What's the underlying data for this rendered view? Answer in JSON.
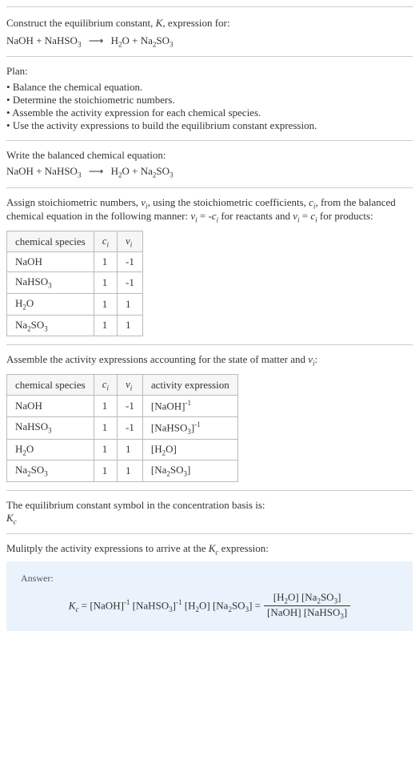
{
  "header": {
    "prompt_line1": "Construct the equilibrium constant, ",
    "prompt_k": "K",
    "prompt_line1b": ", expression for:"
  },
  "equation": {
    "lhs1": "NaOH",
    "plus": " + ",
    "lhs2_a": "NaHSO",
    "lhs2_sub": "3",
    "arrow": "⟶",
    "rhs1_a": "H",
    "rhs1_sub": "2",
    "rhs1_b": "O",
    "rhs2_a": "Na",
    "rhs2_sub1": "2",
    "rhs2_b": "SO",
    "rhs2_sub2": "3"
  },
  "plan": {
    "title": "Plan:",
    "items": [
      "Balance the chemical equation.",
      "Determine the stoichiometric numbers.",
      "Assemble the activity expression for each chemical species.",
      "Use the activity expressions to build the equilibrium constant expression."
    ]
  },
  "balanced": {
    "title": "Write the balanced chemical equation:"
  },
  "stoich": {
    "intro_a": "Assign stoichiometric numbers, ",
    "nu": "ν",
    "sub_i": "i",
    "intro_b": ", using the stoichiometric coefficients, ",
    "c": "c",
    "intro_c": ", from the balanced chemical equation in the following manner: ",
    "eq1": " = -",
    "intro_d": " for reactants and ",
    "eq2": " = ",
    "intro_e": " for products:",
    "headers": {
      "species": "chemical species",
      "c": "c",
      "nu": "ν",
      "i": "i"
    },
    "rows": [
      {
        "species_a": "NaOH",
        "species_sub": "",
        "species_b": "",
        "species_sub2": "",
        "c": "1",
        "nu": "-1"
      },
      {
        "species_a": "NaHSO",
        "species_sub": "3",
        "species_b": "",
        "species_sub2": "",
        "c": "1",
        "nu": "-1"
      },
      {
        "species_a": "H",
        "species_sub": "2",
        "species_b": "O",
        "species_sub2": "",
        "c": "1",
        "nu": "1"
      },
      {
        "species_a": "Na",
        "species_sub": "2",
        "species_b": "SO",
        "species_sub2": "3",
        "c": "1",
        "nu": "1"
      }
    ]
  },
  "activity": {
    "title_a": "Assemble the activity expressions accounting for the state of matter and ",
    "title_b": ":",
    "headers": {
      "species": "chemical species",
      "c": "c",
      "nu": "ν",
      "i": "i",
      "activity": "activity expression"
    },
    "rows": [
      {
        "species_a": "NaOH",
        "species_sub": "",
        "species_b": "",
        "species_sub2": "",
        "c": "1",
        "nu": "-1",
        "act_a": "[NaOH]",
        "act_sup": "-1",
        "act_b": "",
        "act_sub": "",
        "act_c": ""
      },
      {
        "species_a": "NaHSO",
        "species_sub": "3",
        "species_b": "",
        "species_sub2": "",
        "c": "1",
        "nu": "-1",
        "act_a": "[NaHSO",
        "act_sup": "-1",
        "act_b": "",
        "act_sub": "3",
        "act_c": "]"
      },
      {
        "species_a": "H",
        "species_sub": "2",
        "species_b": "O",
        "species_sub2": "",
        "c": "1",
        "nu": "1",
        "act_a": "[H",
        "act_sup": "",
        "act_b": "O]",
        "act_sub": "2",
        "act_c": ""
      },
      {
        "species_a": "Na",
        "species_sub": "2",
        "species_b": "SO",
        "species_sub2": "3",
        "c": "1",
        "nu": "1",
        "act_a": "[Na",
        "act_sup": "",
        "act_b": "SO",
        "act_sub": "2",
        "act_c": ""
      }
    ]
  },
  "eqsymbol": {
    "line1": "The equilibrium constant symbol in the concentration basis is:",
    "k": "K",
    "c": "c"
  },
  "multiply": {
    "line_a": "Mulitply the activity expressions to arrive at the ",
    "k": "K",
    "c": "c",
    "line_b": " expression:"
  },
  "answer": {
    "label": "Answer:",
    "k": "K",
    "c": "c",
    "eq": " = ",
    "t1": "[NaOH]",
    "sup1": "-1",
    "sp": " ",
    "t2a": "[NaHSO",
    "t2sub": "3",
    "t2b": "]",
    "sup2": "-1",
    "t3a": "[H",
    "t3sub": "2",
    "t3b": "O]",
    "t4a": "[Na",
    "t4sub1": "2",
    "t4b": "SO",
    "t4sub2": "3",
    "t4c": "]",
    "eq2": " = ",
    "num_a": "[H",
    "num_sub1": "2",
    "num_b": "O] [Na",
    "num_sub2": "2",
    "num_c": "SO",
    "num_sub3": "3",
    "num_d": "]",
    "den_a": "[NaOH] [NaHSO",
    "den_sub": "3",
    "den_b": "]"
  }
}
